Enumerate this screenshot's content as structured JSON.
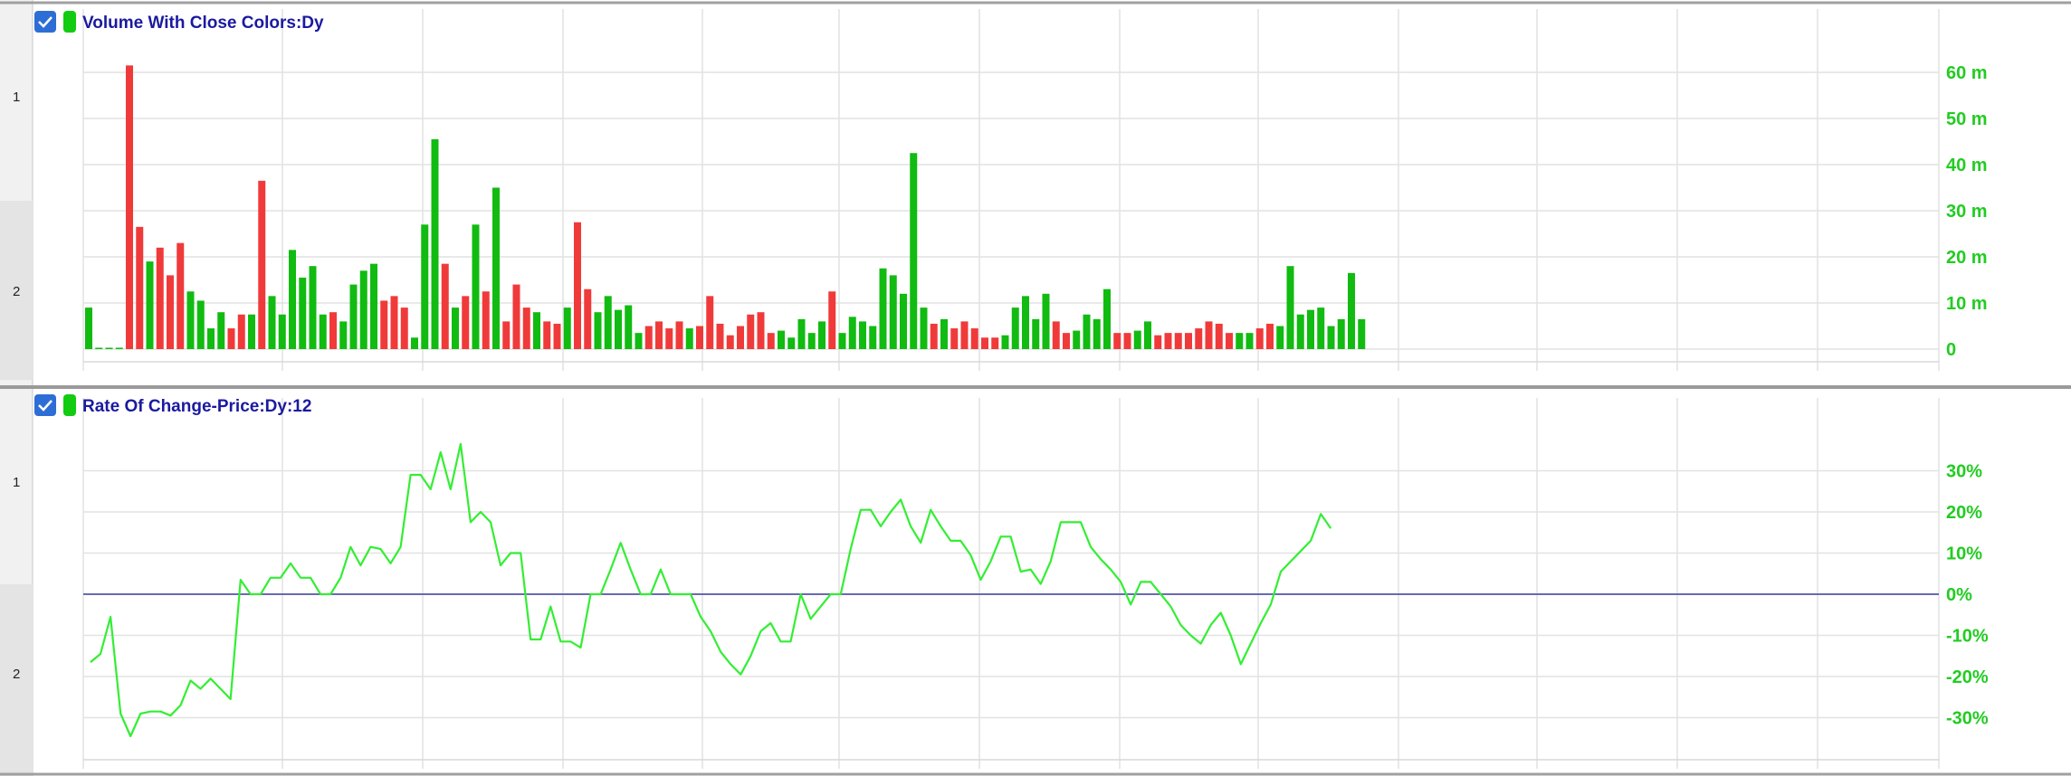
{
  "colors": {
    "up": "#11bb11",
    "down": "#f03a3a",
    "roc_line": "#33ee33",
    "zero_line": "#5656aa",
    "grid": "#e2e2e2",
    "title": "#1a1aa0",
    "axis_text": "#22cc22",
    "checkbox": "#2d6ed6"
  },
  "panes": [
    {
      "title": "Volume With Close Colors:Dy",
      "checkbox_icon": "checkbox-checked-icon",
      "color_swatch_icon": "green-swatch-icon",
      "row_labels": [
        "1",
        "2"
      ]
    },
    {
      "title": "Rate Of Change-Price:Dy:12",
      "checkbox_icon": "checkbox-checked-icon",
      "color_swatch_icon": "green-swatch-icon",
      "row_labels": [
        "1",
        "2"
      ]
    }
  ],
  "chart_data": [
    {
      "type": "bar",
      "title": "Volume With Close Colors:Dy",
      "ylim": [
        0,
        70
      ],
      "y_unit": "m",
      "y_tick_labels": [
        "0",
        "10 m",
        "20 m",
        "30 m",
        "40 m",
        "50 m",
        "60 m"
      ],
      "grid": true,
      "values": [
        9,
        0.3,
        0.3,
        0.3,
        61.5,
        26.5,
        19,
        22,
        16,
        23,
        12.5,
        10.5,
        4.5,
        8,
        4.5,
        7.5,
        7.5,
        36.5,
        11.5,
        7.5,
        21.5,
        15.5,
        18,
        7.5,
        8,
        6,
        14,
        17,
        18.5,
        10.5,
        11.5,
        9,
        2.5,
        27,
        45.5,
        18.5,
        9,
        11.5,
        27,
        12.5,
        35,
        6,
        14,
        9,
        8,
        6,
        5.5,
        9,
        27.5,
        13,
        8,
        11.5,
        8.5,
        9.5,
        3.5,
        5,
        6,
        4.5,
        6,
        4.5,
        5,
        11.5,
        5.5,
        3,
        5,
        7.5,
        8,
        3.5,
        4,
        2.5,
        6.5,
        3.5,
        6,
        12.5,
        3.5,
        7,
        6,
        5,
        17.5,
        16,
        12,
        42.5,
        9,
        5.5,
        6.5,
        4.5,
        6,
        4.5,
        2.5,
        2.5,
        3,
        9,
        11.5,
        6.5,
        12,
        6,
        3.5,
        4,
        7.5,
        6.5,
        13,
        3.5,
        3.5,
        4,
        6,
        3,
        3.5,
        3.5,
        3.5,
        4.5,
        6,
        5.5,
        3.5,
        3.5,
        3.5,
        4.5,
        5.5,
        5,
        18,
        7.5,
        8.5,
        9,
        5,
        6.5,
        16.5,
        6.5
      ],
      "colors": [
        "up",
        "up",
        "up",
        "up",
        "down",
        "down",
        "up",
        "down",
        "down",
        "down",
        "up",
        "up",
        "up",
        "up",
        "down",
        "down",
        "up",
        "down",
        "up",
        "up",
        "up",
        "up",
        "up",
        "up",
        "down",
        "up",
        "up",
        "up",
        "up",
        "down",
        "down",
        "down",
        "up",
        "up",
        "up",
        "down",
        "up",
        "down",
        "up",
        "down",
        "up",
        "down",
        "down",
        "down",
        "up",
        "down",
        "down",
        "up",
        "down",
        "down",
        "up",
        "up",
        "up",
        "up",
        "up",
        "down",
        "down",
        "down",
        "down",
        "up",
        "down",
        "down",
        "down",
        "down",
        "down",
        "down",
        "down",
        "down",
        "up",
        "up",
        "up",
        "up",
        "up",
        "down",
        "up",
        "up",
        "up",
        "up",
        "up",
        "up",
        "up",
        "up",
        "up",
        "down",
        "up",
        "down",
        "down",
        "down",
        "down",
        "down",
        "up",
        "up",
        "up",
        "up",
        "up",
        "down",
        "down",
        "up",
        "up",
        "up",
        "up",
        "down",
        "down",
        "up",
        "up",
        "down",
        "down",
        "down",
        "down",
        "down",
        "down",
        "down",
        "down",
        "up",
        "up",
        "down",
        "down",
        "up",
        "up",
        "up",
        "up",
        "up",
        "up",
        "up",
        "up",
        "up",
        "up"
      ]
    },
    {
      "type": "line",
      "title": "Rate Of Change-Price:Dy:12",
      "ylim": [
        -40,
        40
      ],
      "y_unit": "%",
      "y_tick_labels": [
        "30%",
        "20%",
        "10%",
        "0%",
        "-10%",
        "-20%",
        "-30%"
      ],
      "grid": true,
      "zero_line": true,
      "values": [
        -16.5,
        -14.5,
        -5.5,
        -29,
        -34.5,
        -29,
        -28.5,
        -28.5,
        -29.5,
        -27,
        -21,
        -23,
        -20.5,
        -23,
        -25.5,
        3.5,
        0,
        0,
        4,
        4,
        7.5,
        4,
        4,
        0,
        0,
        4,
        11.5,
        7,
        11.5,
        11,
        7.5,
        11.5,
        29,
        29,
        25.5,
        34.5,
        25.5,
        36.5,
        17.5,
        20,
        17.5,
        7,
        10,
        10,
        -11,
        -11,
        -3,
        -11.5,
        -11.5,
        -13,
        0,
        0,
        6,
        12.5,
        6,
        0,
        0,
        6,
        0,
        0,
        0,
        -5.5,
        -9,
        -14,
        -17,
        -19.5,
        -15,
        -9,
        -7,
        -11.5,
        -11.5,
        0,
        -6,
        -3,
        0,
        0,
        11,
        20.5,
        20.5,
        16.5,
        20,
        23,
        16.5,
        12.5,
        20.5,
        16.5,
        13,
        13,
        9.5,
        3.5,
        8,
        14,
        14,
        5.5,
        6,
        2.5,
        8,
        17.5,
        17.5,
        17.5,
        11.5,
        8.5,
        6,
        3,
        -2.5,
        3,
        3,
        0,
        -3,
        -7.5,
        -10,
        -12,
        -7.5,
        -4.5,
        -10,
        -17,
        -12,
        -7,
        -2.5,
        5.5,
        8,
        10.5,
        13,
        19.5,
        16
      ]
    }
  ]
}
